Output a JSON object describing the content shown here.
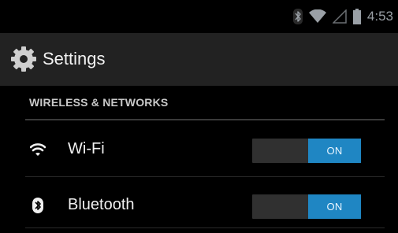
{
  "status_bar": {
    "time": "4:53",
    "icons": [
      "bluetooth-icon",
      "wifi-icon",
      "signal-icon",
      "battery-icon"
    ]
  },
  "action_bar": {
    "title": "Settings",
    "icon": "gear-icon"
  },
  "section": {
    "header": "WIRELESS & NETWORKS"
  },
  "settings": [
    {
      "label": "Wi-Fi",
      "icon": "wifi-icon",
      "toggle": "ON"
    },
    {
      "label": "Bluetooth",
      "icon": "bluetooth-icon",
      "toggle": "ON"
    }
  ],
  "colors": {
    "accent": "#1f86c3",
    "action_bar": "#222222",
    "background": "#000000"
  }
}
